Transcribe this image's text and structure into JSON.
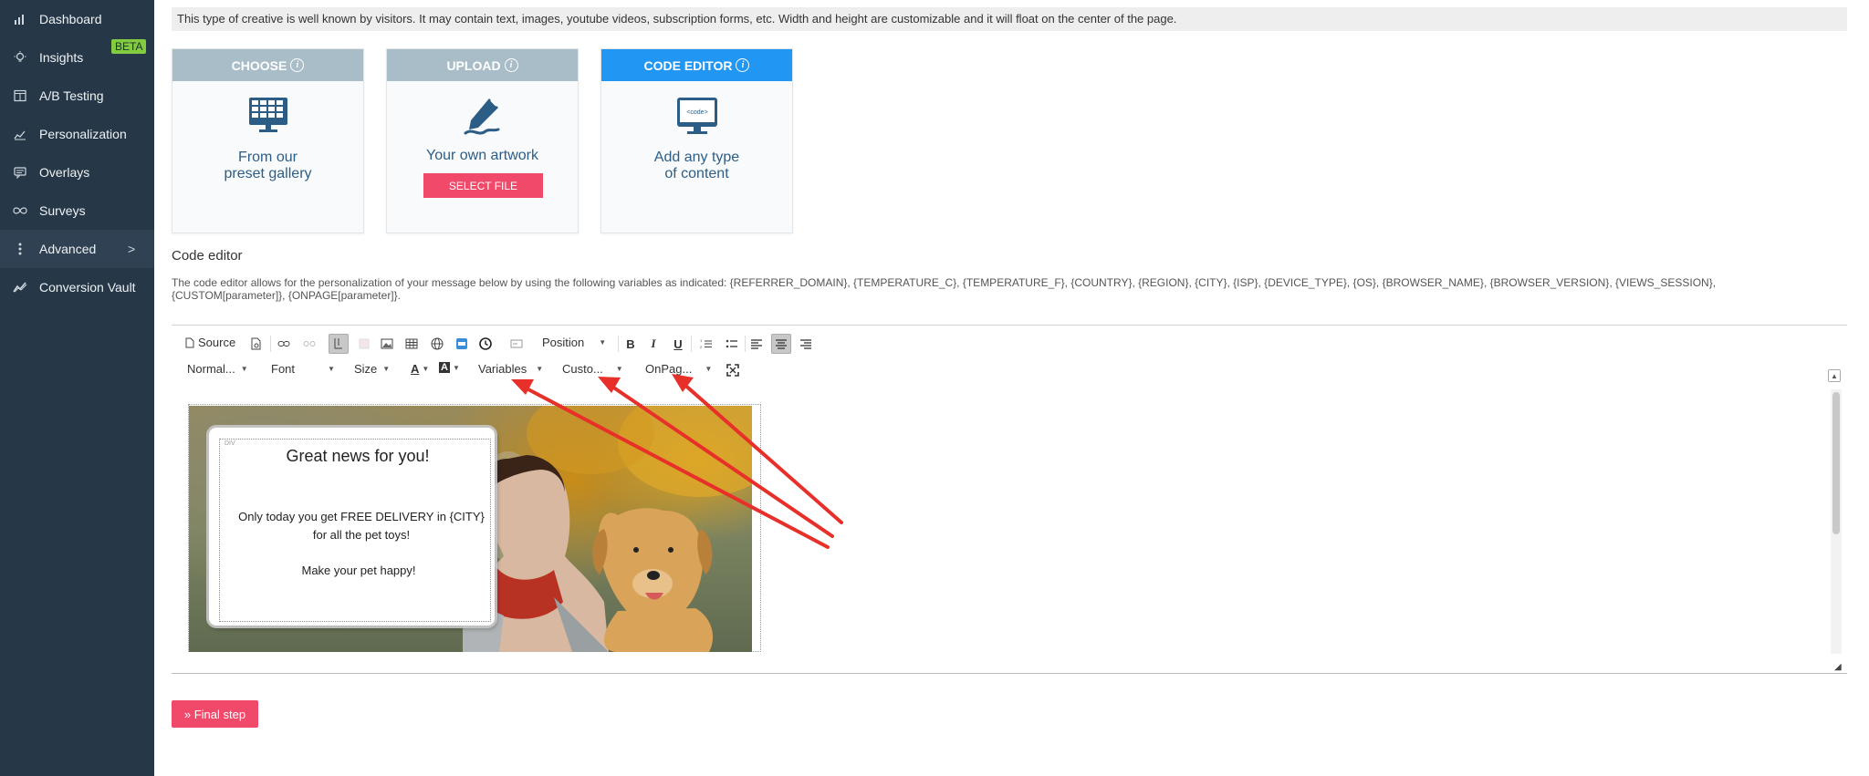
{
  "sidebar": {
    "items": [
      {
        "label": "Dashboard",
        "icon": "bar-chart-icon"
      },
      {
        "label": "Insights",
        "icon": "lightbulb-icon",
        "badge": "BETA"
      },
      {
        "label": "A/B Testing",
        "icon": "split-icon"
      },
      {
        "label": "Personalization",
        "icon": "chart-person-icon"
      },
      {
        "label": "Overlays",
        "icon": "comment-icon"
      },
      {
        "label": "Surveys",
        "icon": "infinity-icon"
      },
      {
        "label": "Advanced",
        "icon": "dots-vertical-icon",
        "chevron": ">"
      },
      {
        "label": "Conversion Vault",
        "icon": "trend-icon"
      }
    ]
  },
  "info_bar": {
    "text": "This type of creative is well known by visitors. It may contain text, images, youtube videos, subscription forms, etc. Width and height are customizable and it will float on the center of the page."
  },
  "cards": {
    "choose": {
      "title": "CHOOSE",
      "line1": "From our",
      "line2": "preset gallery"
    },
    "upload": {
      "title": "UPLOAD",
      "line1": "Your own artwork",
      "button": "SELECT FILE"
    },
    "code_editor": {
      "title": "CODE EDITOR",
      "line1": "Add any type",
      "line2": "of content",
      "icon_text": "<code>"
    }
  },
  "code_editor": {
    "title": "Code editor",
    "description": "The code editor allows for the personalization of your message below by using the following variables as indicated: {REFERRER_DOMAIN}, {TEMPERATURE_C}, {TEMPERATURE_F}, {COUNTRY}, {REGION}, {CITY}, {ISP}, {DEVICE_TYPE}, {OS}, {BROWSER_NAME}, {BROWSER_VERSION}, {VIEWS_SESSION}, {CUSTOM[parameter]}, {ONPAGE[parameter]}."
  },
  "toolbar": {
    "source": "Source",
    "position": "Position",
    "bold": "B",
    "italic": "I",
    "underline": "U",
    "format": "Normal...",
    "font": "Font",
    "size": "Size",
    "text_color": "A",
    "bg_color": "A",
    "variables": "Variables",
    "custom": "Custo...",
    "onpage": "OnPag..."
  },
  "canvas": {
    "div_label": "DIV",
    "title": "Great news for you!",
    "line1": "Only today you get FREE DELIVERY in {CITY} for all the pet toys!",
    "line2": "Make your pet happy!"
  },
  "final_step": "» Final step",
  "colors": {
    "sidebar_bg": "#263847",
    "accent": "#f0496a",
    "card_head": "#a9bdc9",
    "card_head_active": "#2196f3",
    "arrow": "#e8302a"
  }
}
